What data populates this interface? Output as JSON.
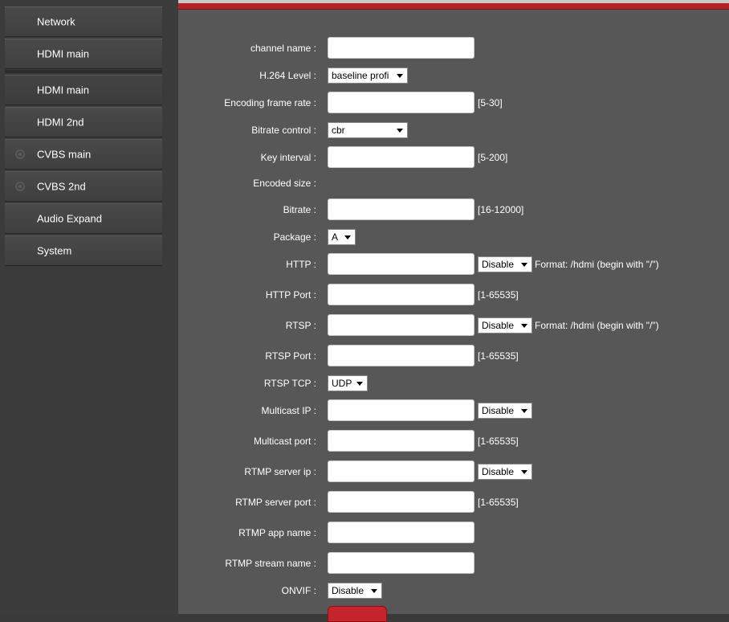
{
  "sidebar": {
    "items": [
      {
        "label": "Network"
      },
      {
        "label": "HDMI main"
      },
      {
        "label": "HDMI main"
      },
      {
        "label": "HDMI 2nd"
      },
      {
        "label": "CVBS main"
      },
      {
        "label": "CVBS 2nd"
      },
      {
        "label": "Audio Expand"
      },
      {
        "label": "System"
      }
    ]
  },
  "form": {
    "channel_name": {
      "label": "channel name :",
      "value": ""
    },
    "h264_level": {
      "label": "H.264 Level :",
      "value": "baseline profi"
    },
    "encoding_frame_rate": {
      "label": "Encoding frame rate :",
      "value": "",
      "hint": "[5-30]"
    },
    "bitrate_control": {
      "label": "Bitrate control :",
      "value": "cbr"
    },
    "key_interval": {
      "label": "Key interval :",
      "value": "",
      "hint": "[5-200]"
    },
    "encoded_size": {
      "label": "Encoded size :"
    },
    "bitrate": {
      "label": "Bitrate :",
      "value": "",
      "hint": "[16-12000]"
    },
    "package": {
      "label": "Package :",
      "value": "A"
    },
    "http": {
      "label": "HTTP :",
      "value": "",
      "select": "Disable",
      "hint": "Format: /hdmi (begin with \"/\")"
    },
    "http_port": {
      "label": "HTTP Port :",
      "value": "",
      "hint": "[1-65535]"
    },
    "rtsp": {
      "label": "RTSP :",
      "value": "",
      "select": "Disable",
      "hint": "Format: /hdmi (begin with \"/\")"
    },
    "rtsp_port": {
      "label": "RTSP Port :",
      "value": "",
      "hint": "[1-65535]"
    },
    "rtsp_tcp": {
      "label": "RTSP TCP :",
      "value": "UDP"
    },
    "multicast_ip": {
      "label": "Multicast IP :",
      "value": "",
      "select": "Disable"
    },
    "multicast_port": {
      "label": "Multicast port :",
      "value": "",
      "hint": "[1-65535]"
    },
    "rtmp_server_ip": {
      "label": "RTMP server ip :",
      "value": "",
      "select": "Disable"
    },
    "rtmp_server_port": {
      "label": "RTMP server port :",
      "value": "",
      "hint": "[1-65535]"
    },
    "rtmp_app_name": {
      "label": "RTMP app name :",
      "value": ""
    },
    "rtmp_stream_name": {
      "label": "RTMP stream name :",
      "value": ""
    },
    "onvif": {
      "label": "ONVIF :",
      "value": "Disable"
    }
  },
  "colors": {
    "accent": "#b52025",
    "panel": "#575757",
    "sidebar": "#3b3b3b"
  }
}
